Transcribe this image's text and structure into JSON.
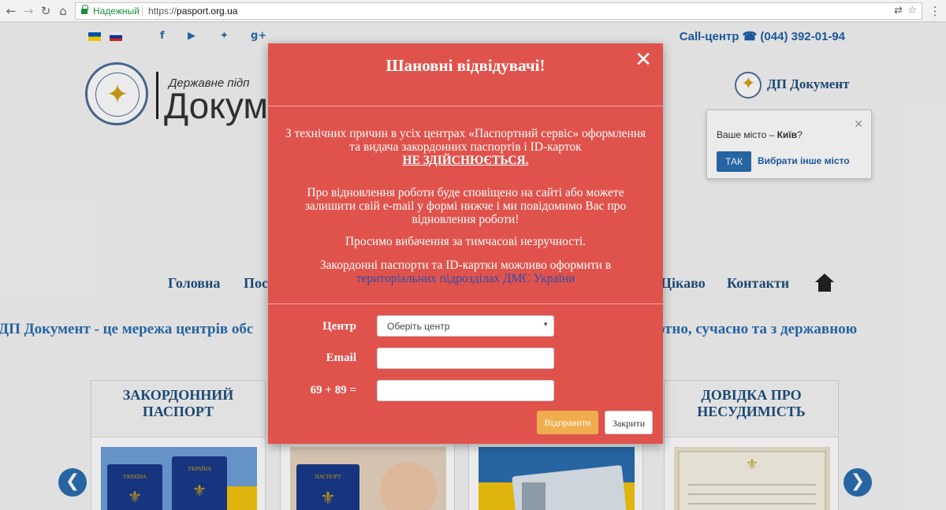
{
  "browser": {
    "secure_label": "Надежный",
    "url_prefix": "https://",
    "url_domain": "pasport.org.ua"
  },
  "header": {
    "call_center": "Call-центр ☎ (044) 392-01-94",
    "social_icons": [
      "facebook-icon",
      "youtube-icon",
      "twitter-icon",
      "google-plus-icon"
    ],
    "logo_sub": "Державне підп",
    "logo_big": "Докуме",
    "brand": "ДП Документ"
  },
  "city_popup": {
    "question_prefix": "Ваше місто – ",
    "city": "Київ",
    "question_suffix": "?",
    "yes_label": "ТАК",
    "other_label": "Вибрати інше місто"
  },
  "menu": {
    "items": [
      {
        "label": "Головна"
      },
      {
        "label": "Пос"
      },
      {
        "label": "Цікаво"
      },
      {
        "label": "Контакти"
      }
    ]
  },
  "tagline": "ДП Документ - це мережа центрів обс                                                                                            о, комфортно, сучасно та з державною",
  "cards": [
    {
      "title_line1": "ЗАКОРДОННИЙ",
      "title_line2": "ПАСПОРТ"
    },
    {
      "title_line1": "ДОВІДКА ПРО",
      "title_line2": "НЕСУДИМІСТЬ"
    }
  ],
  "modal": {
    "title": "Шановні відвідувачі!",
    "close_symbol": "✕",
    "p1_line1": "З технічних причин в усіх центрах «Паспортний сервіс» оформлення",
    "p1_line2": "та видача закордонних паспортів і ID-карток",
    "p1_emph": "НЕ ЗДІЙСНЮЄТЬСЯ.",
    "p2_line1": "Про відновлення роботи буде сповіщено на сайті або можете",
    "p2_line2": "залишити свій e-mail у формі нижче і ми повідомимо Вас про",
    "p2_line3": "відновлення роботи!",
    "p3": "Просимо вибачення за тимчасові незручності.",
    "p4_line1": "Закордонні паспорти та ID-картки можливо оформити в",
    "p4_link": "територіальних підрозділах ДМС України",
    "form": {
      "center_label": "Центр",
      "center_value": "Оберіть центр",
      "email_label": "Email",
      "email_value": "",
      "captcha_label": "69 + 89 =",
      "captcha_value": ""
    },
    "send_label": "Відправити",
    "close_label": "Закрити"
  }
}
